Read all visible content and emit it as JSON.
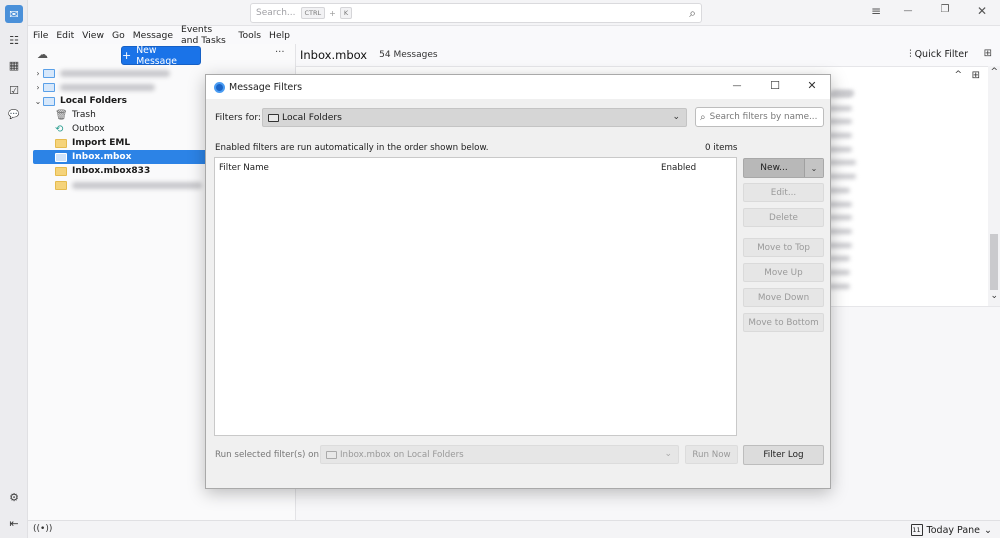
{
  "spaces": [
    {
      "name": "mail",
      "icon": "✉",
      "active": true
    },
    {
      "name": "address-book",
      "icon": "☷"
    },
    {
      "name": "calendar",
      "icon": "▦"
    },
    {
      "name": "tasks",
      "icon": "☑"
    },
    {
      "name": "chat",
      "icon": "💬"
    }
  ],
  "spaces_bottom": {
    "settings_icon": "⚙",
    "collapse_icon": "⇤"
  },
  "titlebar": {
    "search_placeholder": "Search...",
    "shortcut_key1": "CTRL",
    "shortcut_plus": "+",
    "shortcut_key2": "K",
    "search_icon": "⌕",
    "menu_icon": "≡",
    "minimize_icon": "—",
    "restore_icon": "❐",
    "close_icon": "✕"
  },
  "menubar": [
    "File",
    "Edit",
    "View",
    "Go",
    "Message",
    "Events and Tasks",
    "Tools",
    "Help"
  ],
  "folder_pane": {
    "new_message_label": "New Message",
    "new_message_icon": "+",
    "more_icon": "···",
    "get_messages_icon": "☁",
    "folders": [
      {
        "label": "",
        "type": "account",
        "blurred": true,
        "twisty": "›",
        "level": 0
      },
      {
        "label": "",
        "type": "account",
        "blurred": true,
        "twisty": "›",
        "level": 0
      },
      {
        "label": "Local Folders",
        "type": "local",
        "twisty": "⌄",
        "level": 0,
        "bold": true
      },
      {
        "label": "Trash",
        "type": "trash",
        "level": 1
      },
      {
        "label": "Outbox",
        "type": "outbox",
        "level": 1
      },
      {
        "label": "Import EML",
        "type": "folder",
        "level": 1,
        "bold": true
      },
      {
        "label": "Inbox.mbox",
        "type": "folder",
        "level": 1,
        "bold": true,
        "selected": true
      },
      {
        "label": "Inbox.mbox833",
        "type": "folder",
        "level": 1,
        "bold": true
      },
      {
        "label": "",
        "type": "folder",
        "level": 1,
        "blurred": true
      }
    ]
  },
  "thread_pane": {
    "folder_name": "Inbox.mbox",
    "message_count": "54 Messages",
    "quick_filter_label": "Quick Filter",
    "quick_filter_icon": "⫶",
    "layout_icon": "⊞"
  },
  "statusbar": {
    "online_icon": "((•))",
    "today_pane_label": "Today Pane",
    "today_day": "11",
    "today_chevron": "⌄"
  },
  "dialog": {
    "title": "Message Filters",
    "minimize_icon": "—",
    "maximize_icon": "☐",
    "close_icon": "✕",
    "filters_for_label": "Filters for:",
    "filters_for_value": "Local Folders",
    "search_placeholder": "Search filters by name...",
    "search_icon": "⌕",
    "info_text": "Enabled filters are run automatically in the order shown below.",
    "item_count": "0 items",
    "columns": {
      "name": "Filter Name",
      "enabled": "Enabled"
    },
    "filters": [],
    "buttons": {
      "new": "New...",
      "new_dropdown": "⌄",
      "edit": "Edit...",
      "delete": "Delete",
      "move_top": "Move to Top",
      "move_up": "Move Up",
      "move_down": "Move Down",
      "move_bottom": "Move to Bottom",
      "run_now": "Run Now",
      "filter_log": "Filter Log"
    },
    "run_label": "Run selected filter(s) on:",
    "run_on_value": "Inbox.mbox on Local Folders",
    "chevron": "⌄"
  }
}
